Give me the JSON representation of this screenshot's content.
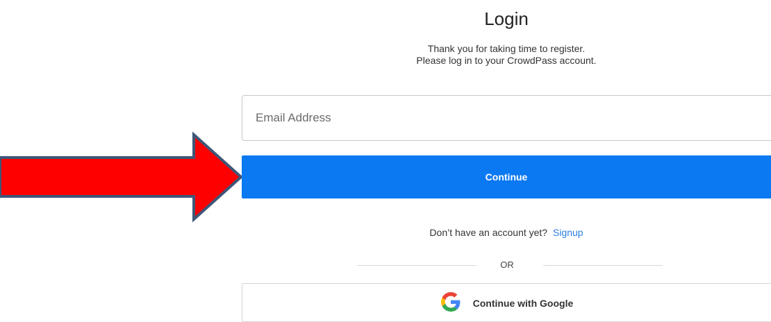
{
  "login": {
    "title": "Login",
    "subtitle_line1": "Thank you for taking time to register.",
    "subtitle_line2": "Please log in to your CrowdPass account.",
    "email_placeholder": "Email Address",
    "email_value": "",
    "continue_label": "Continue",
    "no_account_text": "Don’t have an account yet?",
    "signup_label": "Signup",
    "or_text": "OR",
    "google_label": "Continue with Google"
  },
  "colors": {
    "primary_button": "#0b79f2",
    "link": "#2a7de1",
    "annotation_arrow_fill": "#ff0000",
    "annotation_arrow_stroke": "#3f5778"
  },
  "icons": {
    "google": "google-g-icon",
    "annotation": "red-arrow-annotation"
  }
}
